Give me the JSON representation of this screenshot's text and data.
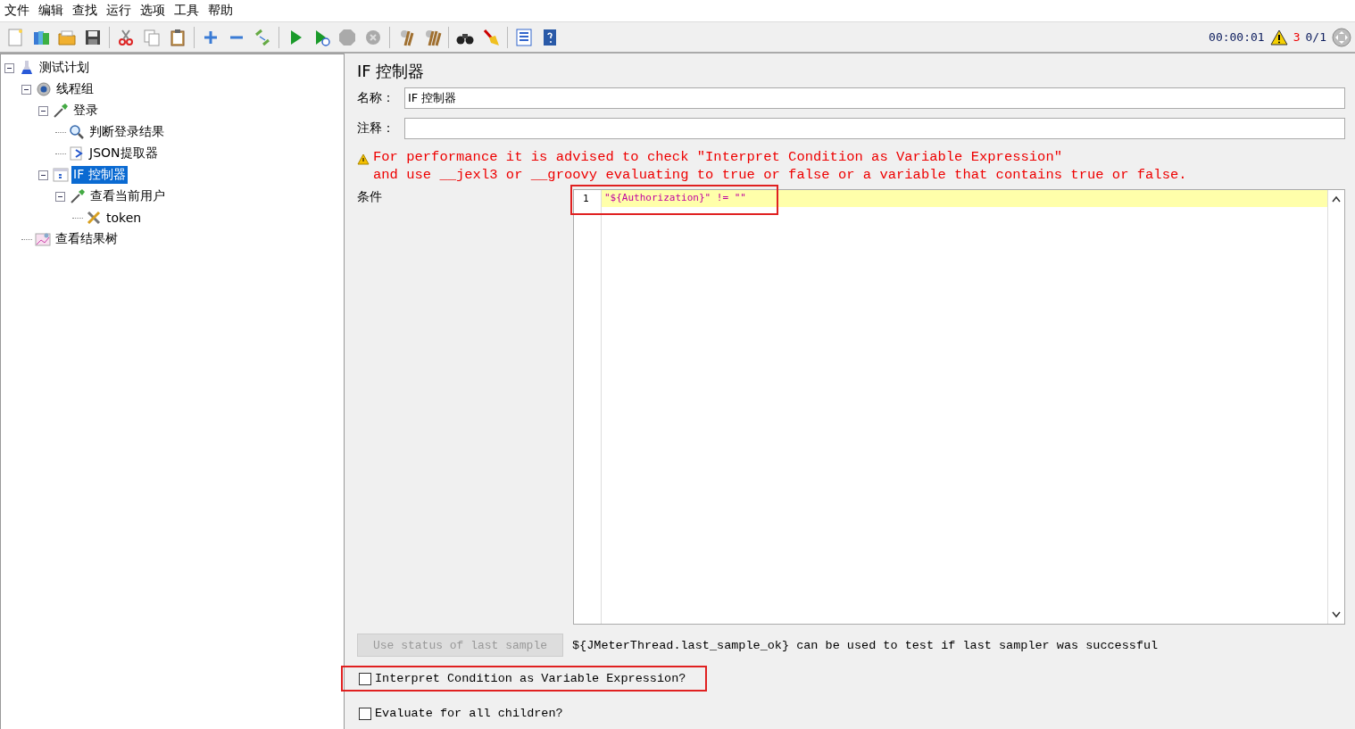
{
  "menu": [
    "文件",
    "编辑",
    "查找",
    "运行",
    "选项",
    "工具",
    "帮助"
  ],
  "toolbar": {
    "timer": "00:00:01",
    "warnings": "3",
    "threads": "0/1"
  },
  "tree": [
    {
      "label": "测试计划",
      "kind": "plan",
      "expanded": true,
      "selected": false,
      "children": [
        {
          "label": "线程组",
          "kind": "threads",
          "expanded": true,
          "selected": false,
          "children": [
            {
              "label": "登录",
              "kind": "sampler",
              "expanded": true,
              "selected": false,
              "children": [
                {
                  "label": "判断登录结果",
                  "kind": "assertion",
                  "selected": false
                },
                {
                  "label": "JSON提取器",
                  "kind": "extractor",
                  "selected": false
                }
              ]
            },
            {
              "label": "IF 控制器",
              "kind": "controller",
              "expanded": true,
              "selected": true,
              "children": [
                {
                  "label": "查看当前用户",
                  "kind": "sampler",
                  "expanded": true,
                  "selected": false,
                  "children": [
                    {
                      "label": "token",
                      "kind": "config",
                      "selected": false
                    }
                  ]
                }
              ]
            }
          ]
        },
        {
          "label": "查看结果树",
          "kind": "listener",
          "selected": false
        }
      ]
    }
  ],
  "panel": {
    "title": "IF 控制器",
    "fields": [
      {
        "label": "名称：",
        "value": "IF 控制器"
      },
      {
        "label": "注释："
      }
    ],
    "warning": [
      "For performance it is advised to check \"Interpret Condition as Variable Expression\"",
      "and use __jexl3 or __groovy evaluating to true or false or a variable that contains true or false."
    ],
    "condition_label": "条件",
    "editor": {
      "lines": [
        {
          "number": "1",
          "code": "\"${Authorization}\" != \"\"",
          "highlighted": true
        }
      ]
    },
    "status_button": {
      "label": "Use status of last sample",
      "disabled": true
    },
    "status_hint": "${JMeterThread.last_sample_ok} can be used to test if last sampler was successful",
    "checkboxes": [
      {
        "label": "Interpret Condition as Variable Expression?",
        "checked": false,
        "highlighted": true
      },
      {
        "label": "Evaluate for all children?",
        "checked": false,
        "highlighted": false
      }
    ]
  }
}
